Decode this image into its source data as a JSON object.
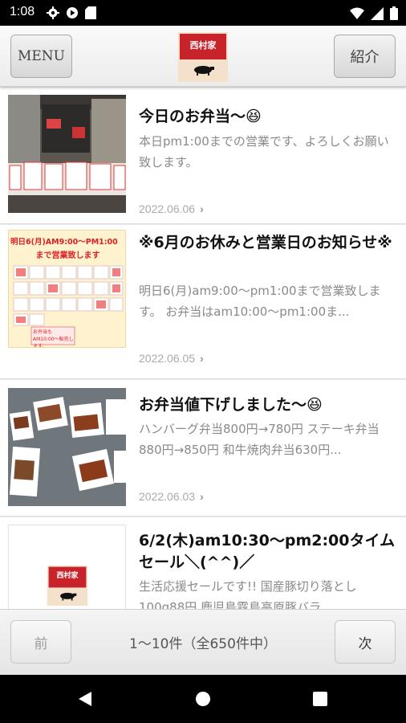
{
  "status_bar": {
    "time": "1:08",
    "icons": [
      "gear-icon",
      "play-icon",
      "sd-card-icon",
      "wifi-icon",
      "signal-icon",
      "battery-icon"
    ]
  },
  "header": {
    "menu_label": "MENU",
    "intro_label": "紹介",
    "logo_text": "西村家"
  },
  "posts": [
    {
      "title": "今日のお弁当〜😆",
      "excerpt": "本日pm1:00までの営業です、よろしくお願い致します。",
      "date": "2022.06.06"
    },
    {
      "title": "※6月のお休みと営業日のお知らせ※",
      "excerpt": "明日6(月)am9:00〜pm1:00まで営業致します。 お弁当はam10:00〜pm1:00ま...",
      "date": "2022.06.05",
      "thumb_text_top": "明日6(月)AM9:00〜PM1:00",
      "thumb_text_mid": "まで営業致します",
      "thumb_text_bottom": "お弁当もAM10:00〜販売します。"
    },
    {
      "title": "お弁当値下げしました〜😆",
      "excerpt": "ハンバーグ弁当800円→780円 ステーキ弁当880円→850円 和牛焼肉弁当630円...",
      "date": "2022.06.03"
    },
    {
      "title": "6/2(木)am10:30〜pm2:00タイムセール＼(^^)／",
      "excerpt": "生活応援セールです!! 国産豚切り落とし100g88円 鹿児島霧島高原豚バラ",
      "logo_text": "西村家"
    }
  ],
  "footer": {
    "prev_label": "前",
    "page_info": "1〜10件（全650件中）",
    "next_label": "次"
  },
  "colors": {
    "logo_red": "#c8232a",
    "header_bg": "#f0f0f0",
    "title_text": "#111111",
    "excerpt_text": "#8a8a8a",
    "date_text": "#aaaaaa"
  }
}
